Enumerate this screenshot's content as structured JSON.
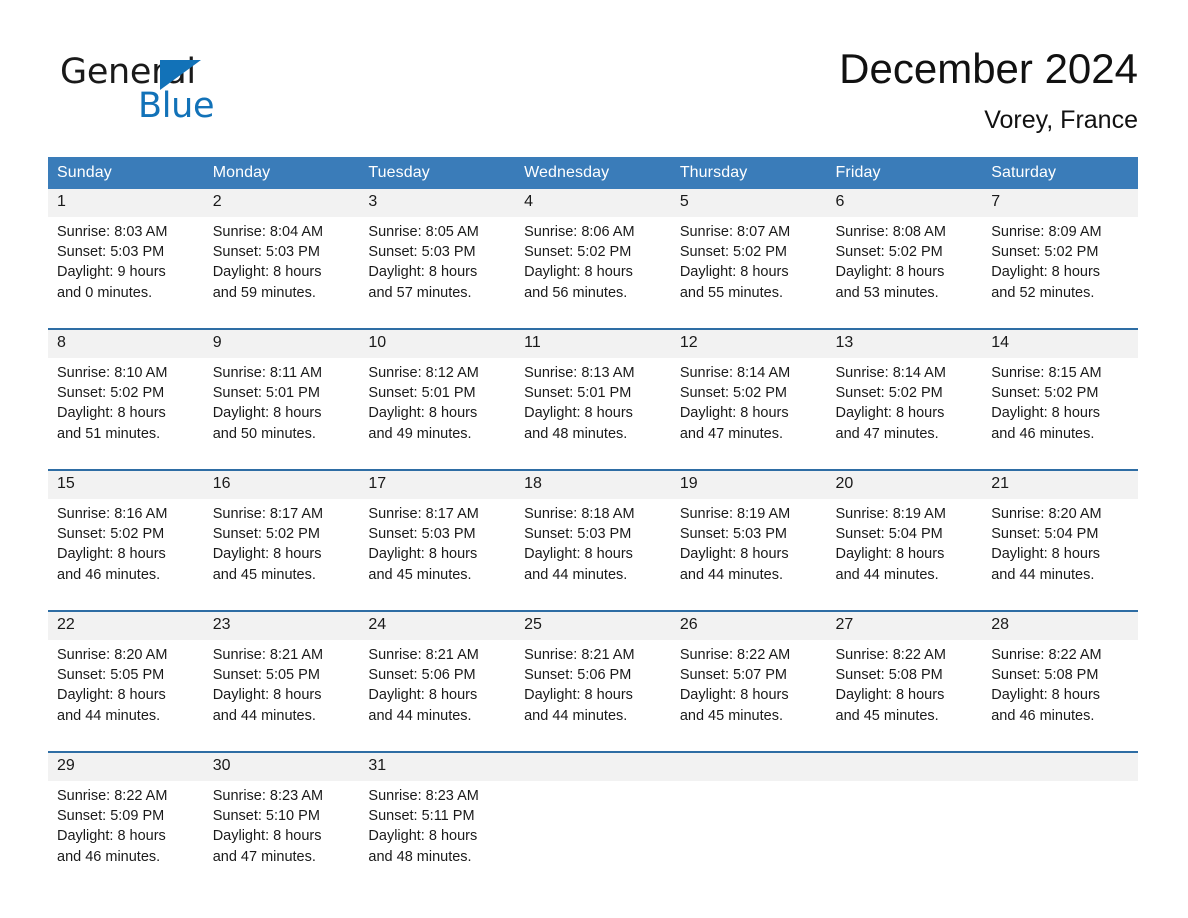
{
  "brand": {
    "name_part1": "General",
    "name_part2": "Blue",
    "triangle_color": "#1272b8"
  },
  "header": {
    "month_title": "December 2024",
    "location": "Vorey, France",
    "header_bg_color": "#3a7cb9",
    "row_divider_color": "#2e6da4",
    "date_cell_bg": "#f2f2f2"
  },
  "calendar": {
    "weekday_headers": [
      "Sunday",
      "Monday",
      "Tuesday",
      "Wednesday",
      "Thursday",
      "Friday",
      "Saturday"
    ],
    "weeks": [
      {
        "dates": [
          "1",
          "2",
          "3",
          "4",
          "5",
          "6",
          "7"
        ],
        "cells": [
          {
            "sunrise": "Sunrise: 8:03 AM",
            "sunset": "Sunset: 5:03 PM",
            "daylight1": "Daylight: 9 hours",
            "daylight2": "and 0 minutes."
          },
          {
            "sunrise": "Sunrise: 8:04 AM",
            "sunset": "Sunset: 5:03 PM",
            "daylight1": "Daylight: 8 hours",
            "daylight2": "and 59 minutes."
          },
          {
            "sunrise": "Sunrise: 8:05 AM",
            "sunset": "Sunset: 5:03 PM",
            "daylight1": "Daylight: 8 hours",
            "daylight2": "and 57 minutes."
          },
          {
            "sunrise": "Sunrise: 8:06 AM",
            "sunset": "Sunset: 5:02 PM",
            "daylight1": "Daylight: 8 hours",
            "daylight2": "and 56 minutes."
          },
          {
            "sunrise": "Sunrise: 8:07 AM",
            "sunset": "Sunset: 5:02 PM",
            "daylight1": "Daylight: 8 hours",
            "daylight2": "and 55 minutes."
          },
          {
            "sunrise": "Sunrise: 8:08 AM",
            "sunset": "Sunset: 5:02 PM",
            "daylight1": "Daylight: 8 hours",
            "daylight2": "and 53 minutes."
          },
          {
            "sunrise": "Sunrise: 8:09 AM",
            "sunset": "Sunset: 5:02 PM",
            "daylight1": "Daylight: 8 hours",
            "daylight2": "and 52 minutes."
          }
        ]
      },
      {
        "dates": [
          "8",
          "9",
          "10",
          "11",
          "12",
          "13",
          "14"
        ],
        "cells": [
          {
            "sunrise": "Sunrise: 8:10 AM",
            "sunset": "Sunset: 5:02 PM",
            "daylight1": "Daylight: 8 hours",
            "daylight2": "and 51 minutes."
          },
          {
            "sunrise": "Sunrise: 8:11 AM",
            "sunset": "Sunset: 5:01 PM",
            "daylight1": "Daylight: 8 hours",
            "daylight2": "and 50 minutes."
          },
          {
            "sunrise": "Sunrise: 8:12 AM",
            "sunset": "Sunset: 5:01 PM",
            "daylight1": "Daylight: 8 hours",
            "daylight2": "and 49 minutes."
          },
          {
            "sunrise": "Sunrise: 8:13 AM",
            "sunset": "Sunset: 5:01 PM",
            "daylight1": "Daylight: 8 hours",
            "daylight2": "and 48 minutes."
          },
          {
            "sunrise": "Sunrise: 8:14 AM",
            "sunset": "Sunset: 5:02 PM",
            "daylight1": "Daylight: 8 hours",
            "daylight2": "and 47 minutes."
          },
          {
            "sunrise": "Sunrise: 8:14 AM",
            "sunset": "Sunset: 5:02 PM",
            "daylight1": "Daylight: 8 hours",
            "daylight2": "and 47 minutes."
          },
          {
            "sunrise": "Sunrise: 8:15 AM",
            "sunset": "Sunset: 5:02 PM",
            "daylight1": "Daylight: 8 hours",
            "daylight2": "and 46 minutes."
          }
        ]
      },
      {
        "dates": [
          "15",
          "16",
          "17",
          "18",
          "19",
          "20",
          "21"
        ],
        "cells": [
          {
            "sunrise": "Sunrise: 8:16 AM",
            "sunset": "Sunset: 5:02 PM",
            "daylight1": "Daylight: 8 hours",
            "daylight2": "and 46 minutes."
          },
          {
            "sunrise": "Sunrise: 8:17 AM",
            "sunset": "Sunset: 5:02 PM",
            "daylight1": "Daylight: 8 hours",
            "daylight2": "and 45 minutes."
          },
          {
            "sunrise": "Sunrise: 8:17 AM",
            "sunset": "Sunset: 5:03 PM",
            "daylight1": "Daylight: 8 hours",
            "daylight2": "and 45 minutes."
          },
          {
            "sunrise": "Sunrise: 8:18 AM",
            "sunset": "Sunset: 5:03 PM",
            "daylight1": "Daylight: 8 hours",
            "daylight2": "and 44 minutes."
          },
          {
            "sunrise": "Sunrise: 8:19 AM",
            "sunset": "Sunset: 5:03 PM",
            "daylight1": "Daylight: 8 hours",
            "daylight2": "and 44 minutes."
          },
          {
            "sunrise": "Sunrise: 8:19 AM",
            "sunset": "Sunset: 5:04 PM",
            "daylight1": "Daylight: 8 hours",
            "daylight2": "and 44 minutes."
          },
          {
            "sunrise": "Sunrise: 8:20 AM",
            "sunset": "Sunset: 5:04 PM",
            "daylight1": "Daylight: 8 hours",
            "daylight2": "and 44 minutes."
          }
        ]
      },
      {
        "dates": [
          "22",
          "23",
          "24",
          "25",
          "26",
          "27",
          "28"
        ],
        "cells": [
          {
            "sunrise": "Sunrise: 8:20 AM",
            "sunset": "Sunset: 5:05 PM",
            "daylight1": "Daylight: 8 hours",
            "daylight2": "and 44 minutes."
          },
          {
            "sunrise": "Sunrise: 8:21 AM",
            "sunset": "Sunset: 5:05 PM",
            "daylight1": "Daylight: 8 hours",
            "daylight2": "and 44 minutes."
          },
          {
            "sunrise": "Sunrise: 8:21 AM",
            "sunset": "Sunset: 5:06 PM",
            "daylight1": "Daylight: 8 hours",
            "daylight2": "and 44 minutes."
          },
          {
            "sunrise": "Sunrise: 8:21 AM",
            "sunset": "Sunset: 5:06 PM",
            "daylight1": "Daylight: 8 hours",
            "daylight2": "and 44 minutes."
          },
          {
            "sunrise": "Sunrise: 8:22 AM",
            "sunset": "Sunset: 5:07 PM",
            "daylight1": "Daylight: 8 hours",
            "daylight2": "and 45 minutes."
          },
          {
            "sunrise": "Sunrise: 8:22 AM",
            "sunset": "Sunset: 5:08 PM",
            "daylight1": "Daylight: 8 hours",
            "daylight2": "and 45 minutes."
          },
          {
            "sunrise": "Sunrise: 8:22 AM",
            "sunset": "Sunset: 5:08 PM",
            "daylight1": "Daylight: 8 hours",
            "daylight2": "and 46 minutes."
          }
        ]
      },
      {
        "dates": [
          "29",
          "30",
          "31",
          "",
          "",
          "",
          ""
        ],
        "cells": [
          {
            "sunrise": "Sunrise: 8:22 AM",
            "sunset": "Sunset: 5:09 PM",
            "daylight1": "Daylight: 8 hours",
            "daylight2": "and 46 minutes."
          },
          {
            "sunrise": "Sunrise: 8:23 AM",
            "sunset": "Sunset: 5:10 PM",
            "daylight1": "Daylight: 8 hours",
            "daylight2": "and 47 minutes."
          },
          {
            "sunrise": "Sunrise: 8:23 AM",
            "sunset": "Sunset: 5:11 PM",
            "daylight1": "Daylight: 8 hours",
            "daylight2": "and 48 minutes."
          },
          {
            "sunrise": "",
            "sunset": "",
            "daylight1": "",
            "daylight2": ""
          },
          {
            "sunrise": "",
            "sunset": "",
            "daylight1": "",
            "daylight2": ""
          },
          {
            "sunrise": "",
            "sunset": "",
            "daylight1": "",
            "daylight2": ""
          },
          {
            "sunrise": "",
            "sunset": "",
            "daylight1": "",
            "daylight2": ""
          }
        ]
      }
    ]
  }
}
